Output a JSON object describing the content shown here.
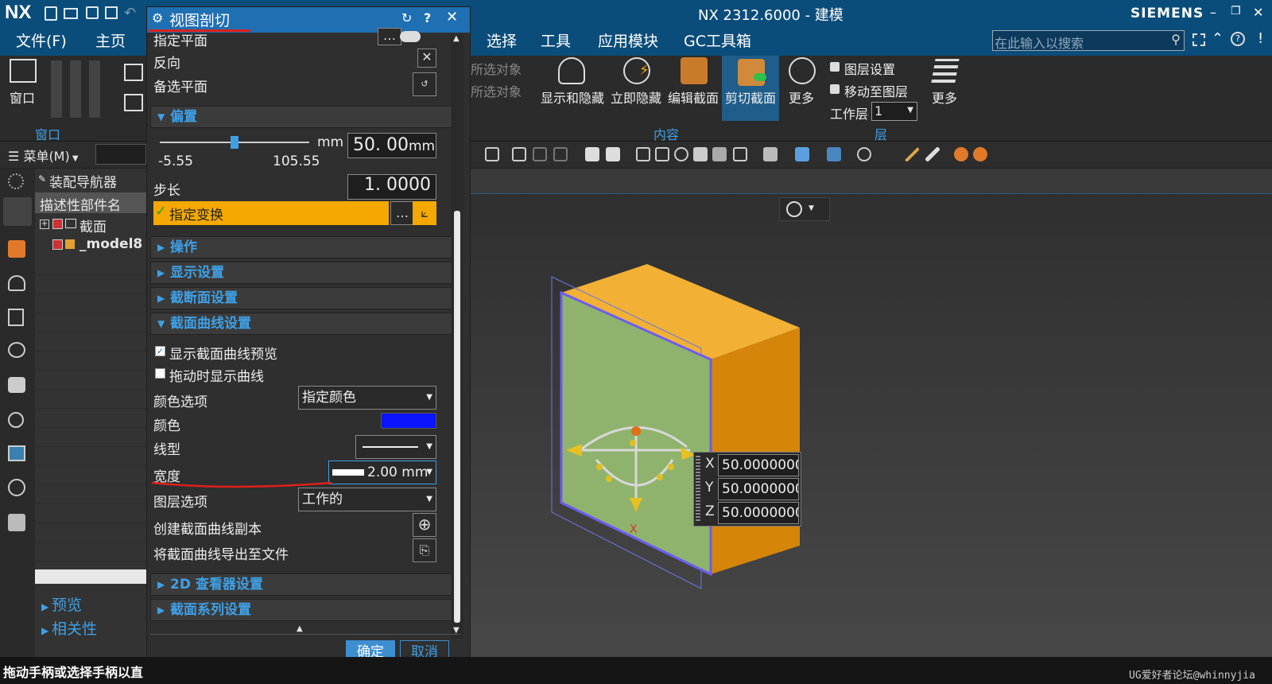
{
  "app": {
    "logo": "NX",
    "title": "NX 2312.6000 - 建模",
    "brand": "SIEMENS",
    "window_controls": [
      "–",
      "❐",
      "✕"
    ]
  },
  "menubar": {
    "items": [
      "文件(F)",
      "主页",
      "选择",
      "工具",
      "应用模块",
      "GC工具箱"
    ],
    "search_placeholder": "在此输入以搜索"
  },
  "ribbon": {
    "window_label": "窗口",
    "window_group": "窗口",
    "selected_obj_1": "所选对象",
    "selected_obj_2": "所选对象",
    "buttons": [
      "显示和隐藏",
      "立即隐藏",
      "编辑截面",
      "剪切截面",
      "更多"
    ],
    "content_group": "内容",
    "layer_settings": "图层设置",
    "move_to_layer": "移动至图层",
    "work_layer_label": "工作层",
    "work_layer_value": "1",
    "layer_more": "更多",
    "layer_group": "层"
  },
  "nav": {
    "menu_label": "菜单(M)",
    "assembly_nav": "装配导航器",
    "column_header": "描述性部件名",
    "tree": [
      "截面",
      "_model8"
    ],
    "preview": "预览",
    "relevance": "相关性"
  },
  "dialog": {
    "title": "视图剖切",
    "top_cut_label": "指定平面",
    "reverse": "反向",
    "alt_plane": "备选平面",
    "offset_section": "偏置",
    "unit_mm": "mm",
    "offset_value": "50. 00",
    "offset_unit": "mm",
    "slider_min": "-5.55",
    "slider_max": "105.55",
    "slider_fraction": 0.5,
    "step_label": "步长",
    "step_value": "1. 0000",
    "transform_label": "指定变换",
    "sections": [
      "操作",
      "显示设置",
      "截断面设置",
      "截面曲线设置"
    ],
    "show_preview": "显示截面曲线预览",
    "show_preview_checked": true,
    "drag_show": "拖动时显示曲线",
    "drag_show_checked": false,
    "color_option_label": "颜色选项",
    "color_option_value": "指定颜色",
    "color_label": "颜色",
    "color_value": "#0a14ff",
    "linetype_label": "线型",
    "width_label": "宽度",
    "width_value": "2.00 mm",
    "layer_option_label": "图层选项",
    "layer_option_value": "工作的",
    "create_copy": "创建截面曲线副本",
    "export_curve": "将截面曲线导出至文件",
    "viewer_settings": "2D 查看器设置",
    "series_settings": "截面系列设置",
    "ok": "确定",
    "cancel": "取消"
  },
  "viewport": {
    "axis_x_label": "X",
    "x_label": "X",
    "y_label": "Y",
    "z_label": "Z",
    "x_value": "50.0000000",
    "y_value": "50.0000000",
    "z_value": "50.0000000"
  },
  "status": {
    "text": "拖动手柄或选择手柄以直",
    "watermark": "UG爱好者论坛@whinnyjia"
  },
  "colors": {
    "title_blue": "#0b4d7a",
    "dialog_title": "#1f6fb3",
    "accent_blue": "#3fa0e6",
    "transform_highlight": "#f5a800",
    "ok_button": "#3d8fd1",
    "box_orange": "#f0a623",
    "section_green": "#8fb36d",
    "annotation_red": "#e0201a"
  }
}
